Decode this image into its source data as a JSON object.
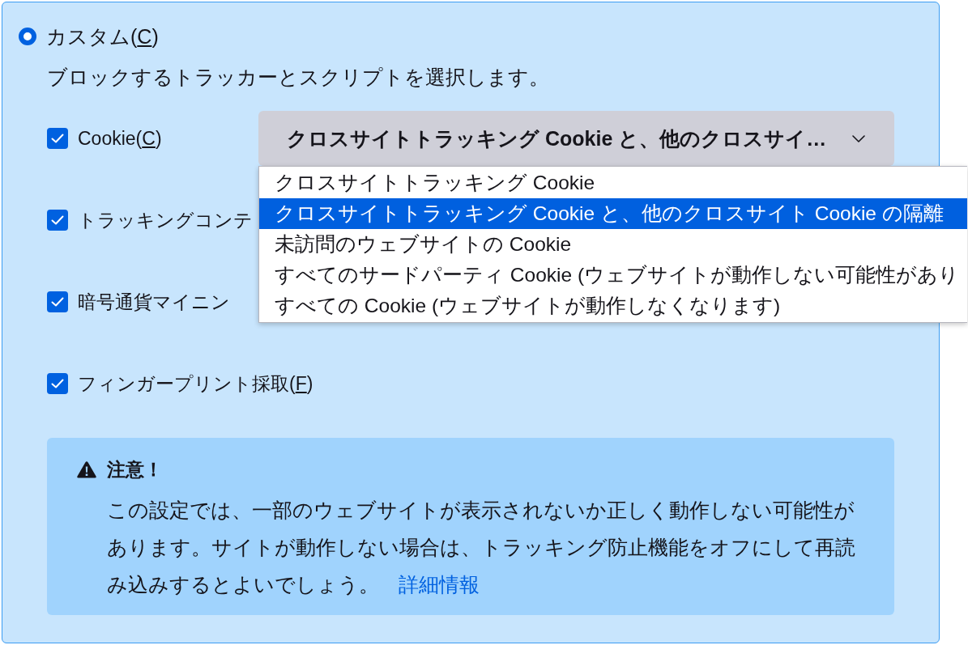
{
  "custom_option": {
    "label": "カスタム(C)",
    "selected": true
  },
  "description": "ブロックするトラッカーとスクリプトを選択します。",
  "blockers": [
    {
      "label": "Cookie(C)",
      "checked": true,
      "dropdown": {
        "value": "クロスサイトトラッキング Cookie と、他のクロスサイ…",
        "expanded": true,
        "options": [
          {
            "label": "クロスサイトトラッキング Cookie",
            "selected": false
          },
          {
            "label": "クロスサイトトラッキング Cookie と、他のクロスサイト Cookie の隔離",
            "selected": true
          },
          {
            "label": "未訪問のウェブサイトの Cookie",
            "selected": false
          },
          {
            "label": "すべてのサードパーティ Cookie (ウェブサイトが動作しない可能性があり",
            "selected": false
          },
          {
            "label": "すべての Cookie (ウェブサイトが動作しなくなります)",
            "selected": false
          }
        ]
      }
    },
    {
      "label": "トラッキングコンテ",
      "checked": true
    },
    {
      "label": "暗号通貨マイニン",
      "checked": true
    },
    {
      "label": "フィンガープリント採取(F)",
      "checked": true
    }
  ],
  "warning": {
    "title": "注意！",
    "body": "この設定では、一部のウェブサイトが表示されないか正しく動作しない可能性があります。サイトが動作しない場合は、トラッキング防止機能をオフにして再読み込みするとよいでしょう。",
    "link": "詳細情報"
  }
}
